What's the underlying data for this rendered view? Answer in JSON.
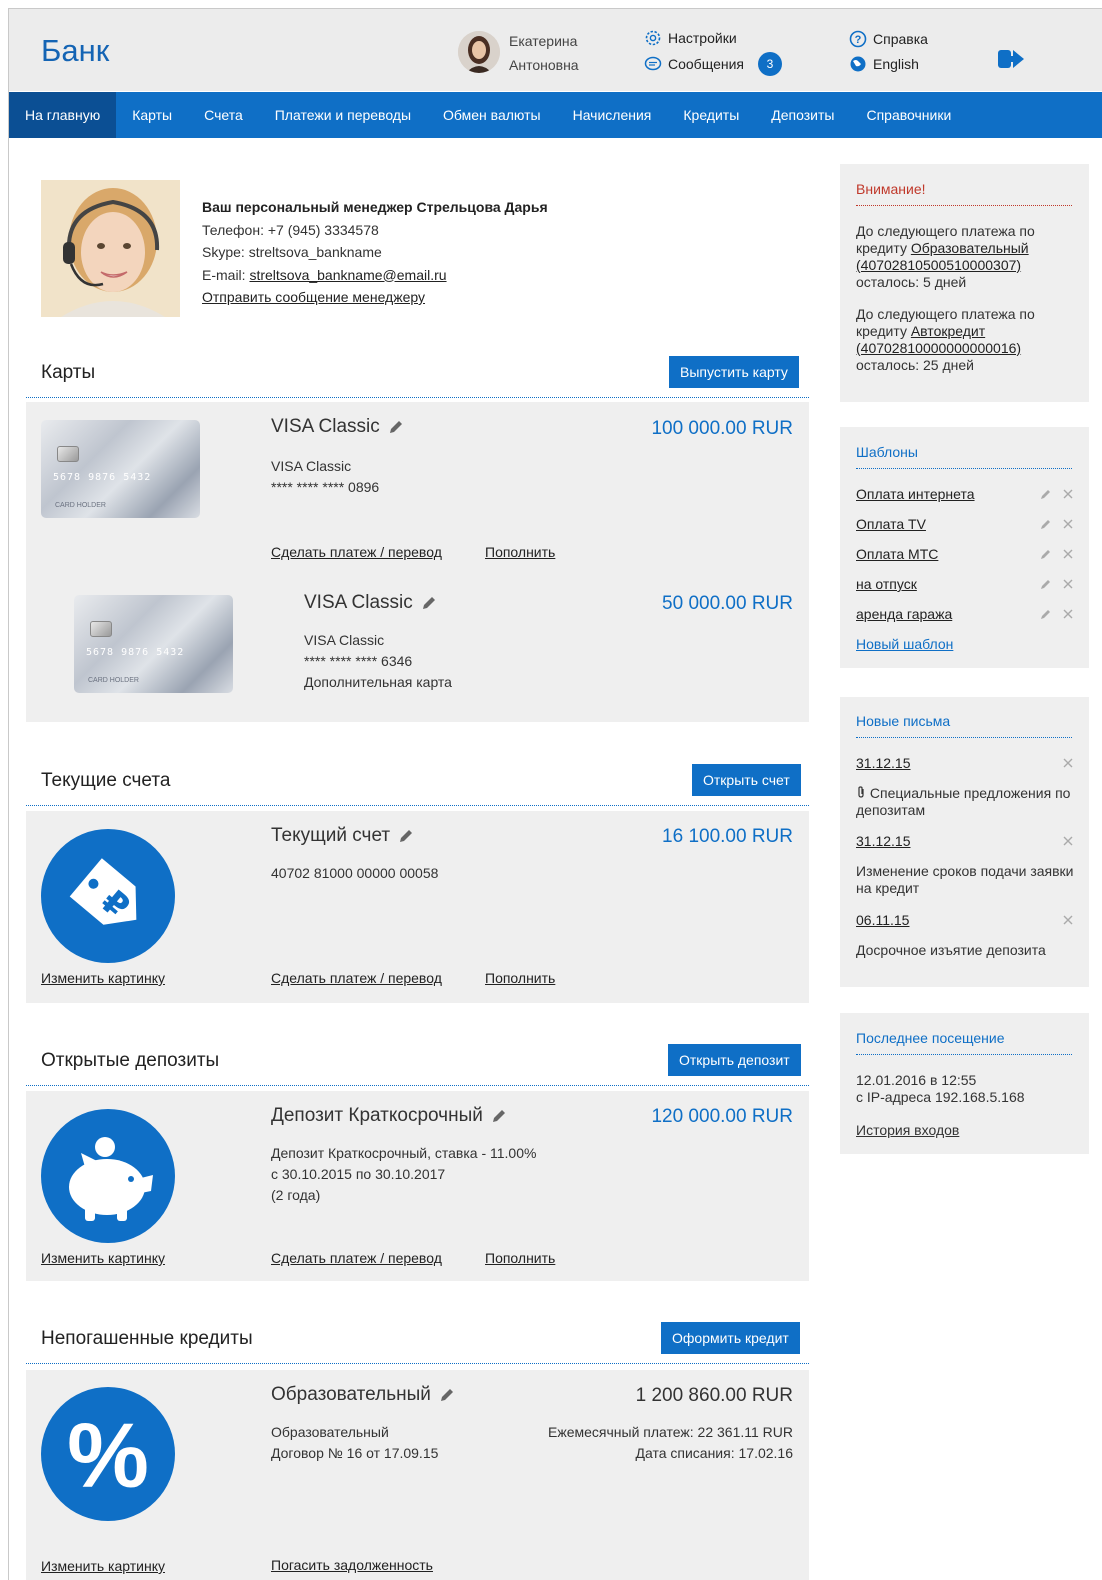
{
  "header": {
    "logo": "Банк",
    "user_first": "Екатерина",
    "user_last": "Антоновна",
    "settings": "Настройки",
    "messages": "Сообщения",
    "messages_count": "3",
    "help": "Справка",
    "language": "English"
  },
  "nav": [
    "На главную",
    "Карты",
    "Счета",
    "Платежи и переводы",
    "Обмен валюты",
    "Начисления",
    "Кредиты",
    "Депозиты",
    "Справочники"
  ],
  "manager": {
    "title": "Ваш персональный менеджер Стрельцова Дарья",
    "phone": "Телефон: +7 (945) 3334578",
    "skype": "Skype: streltsova_bankname",
    "email_label": "E-mail: ",
    "email": "streltsova_bankname@email.ru",
    "send_message": "Отправить сообщение менеджеру"
  },
  "cards": {
    "title": "Карты",
    "button": "Выпустить карту",
    "card_number_print": "5678 9876 5432",
    "card_holder": "CARD HOLDER",
    "items": [
      {
        "name": "VISA Classic",
        "amount": "100 000.00 RUR",
        "type": "VISA Classic",
        "number": "**** **** **** 0896",
        "pay_link": "Сделать платеж / перевод",
        "topup_link": "Пополнить"
      },
      {
        "name": "VISA Classic",
        "amount": "50 000.00 RUR",
        "type": "VISA Classic",
        "number": "**** **** **** 6346",
        "note": "Дополнительная карта"
      }
    ]
  },
  "accounts": {
    "title": "Текущие счета",
    "button": "Открыть счет",
    "name": "Текущий счет",
    "amount": "16 100.00 RUR",
    "number": "40702 81000 00000 00058",
    "change_pic": "Изменить картинку",
    "pay_link": "Сделать платеж / перевод",
    "topup_link": "Пополнить"
  },
  "deposits": {
    "title": "Открытые депозиты",
    "button": "Открыть депозит",
    "name": "Депозит Краткосрочный",
    "amount": "120 000.00 RUR",
    "line1": "Депозит Краткосрочный, ставка - 11.00%",
    "line2": "с 30.10.2015 по 30.10.2017",
    "line3": "(2 года)",
    "change_pic": "Изменить картинку",
    "pay_link": "Сделать платеж / перевод",
    "topup_link": "Пополнить"
  },
  "credits": {
    "title": "Непогашенные кредиты",
    "button": "Оформить кредит",
    "name": "Образовательный",
    "amount": "1 200 860.00 RUR",
    "line1": "Образовательный",
    "line2": "Договор № 16 от 17.09.15",
    "monthly": "Ежемесячный платеж: 22 361.11 RUR",
    "date": "Дата списания: 17.02.16",
    "change_pic": "Изменить картинку",
    "repay_link": "Погасить задолженность"
  },
  "attention": {
    "title": "Внимание!",
    "p1_pre": "До следующего платежа по кредиту ",
    "p1_link": "Образовательный (40702810500510000307)",
    "p1_post": "осталось: 5 дней",
    "p2_pre": "До следующего платежа по кредиту ",
    "p2_link": "Автокредит (40702810000000000016)",
    "p2_post": "осталось: 25 дней"
  },
  "templates": {
    "title": "Шаблоны",
    "items": [
      "Оплата интернета",
      "Оплата TV",
      "Оплата МТС",
      "на отпуск",
      "аренда гаража"
    ],
    "new": "Новый шаблон"
  },
  "letters": {
    "title": "Новые письма",
    "items": [
      {
        "date": "31.12.15",
        "text": "Специальные предложения по депозитам"
      },
      {
        "date": "31.12.15",
        "text": "Изменение сроков подачи заявки на кредит"
      },
      {
        "date": "06.11.15",
        "text": "Досрочное изъятие депозита"
      }
    ]
  },
  "last_visit": {
    "title": "Последнее посещение",
    "when": "12.01.2016 в 12:55",
    "ip": "с IP-адреса 192.168.5.168",
    "history": "История входов"
  },
  "colors": {
    "accent": "#0f6fc6",
    "nav_active": "#0b4f94",
    "panel": "#efefef",
    "alert": "#c0392b"
  }
}
